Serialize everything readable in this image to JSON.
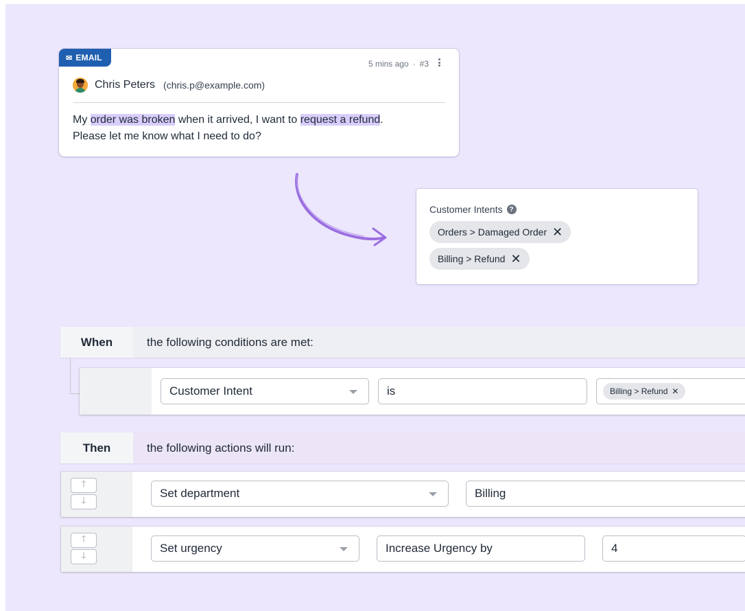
{
  "email": {
    "tag": "EMAIL",
    "time": "5 mins ago",
    "separator": "·",
    "id": "#3",
    "sender_name": "Chris Peters",
    "sender_email": "(chris.p@example.com)",
    "body": {
      "p1": "My ",
      "h1": "order was broken",
      "p2": " when it arrived, I want to ",
      "h2": "request a refund",
      "p3": ".",
      "line2": "Please let me know what I need to do?"
    }
  },
  "intents": {
    "title": "Customer Intents",
    "help": "?",
    "chips": [
      "Orders > Damaged Order",
      "Billing > Refund"
    ],
    "remove": "✕"
  },
  "rules": {
    "when_label": "When",
    "when_desc": "the following conditions are met:",
    "condition": {
      "field": "Customer Intent",
      "operator": "is",
      "value_chip": "Billing > Refund",
      "value_remove": "✕"
    },
    "then_label": "Then",
    "then_desc": "the following actions will run:",
    "actions": [
      {
        "action": "Set department",
        "value": "Billing"
      },
      {
        "action": "Set urgency",
        "value": "Increase Urgency by",
        "amount": "4"
      }
    ],
    "up": "🡑",
    "down": "🡓"
  },
  "colors": {
    "background": "#ece7fc",
    "email_tag": "#1f5fb0",
    "highlight": "#d9cdfb",
    "arrow": "#9b6ee0"
  }
}
